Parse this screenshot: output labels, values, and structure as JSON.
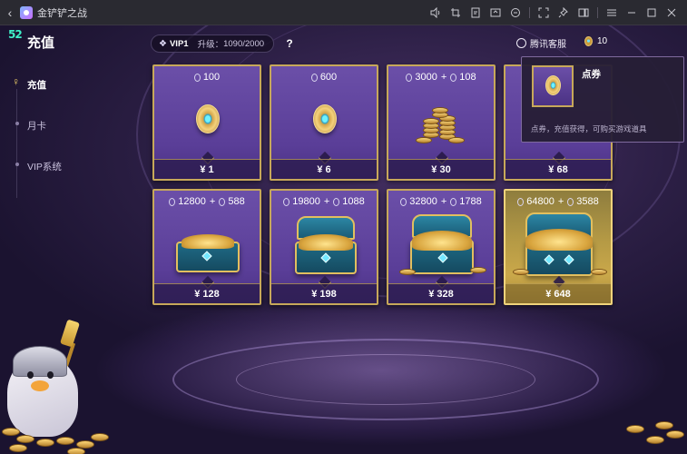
{
  "window": {
    "title": "金铲铲之战",
    "back_icon": "chevron-left-icon"
  },
  "header": {
    "page_title": "充值",
    "logo_text": "52",
    "vip": {
      "level": "VIP1",
      "upgrade_label": "升级：",
      "progress_current": "1090",
      "progress_total": "/2000"
    },
    "help_label": "?",
    "service_label": "腾讯客服",
    "coupon_balance": "10"
  },
  "nav": {
    "items": [
      {
        "label": "充值",
        "active": true
      },
      {
        "label": "月卡",
        "active": false
      },
      {
        "label": "VIP系统",
        "active": false
      }
    ]
  },
  "products": [
    {
      "amount": "100",
      "bonus": "",
      "price": "¥  1",
      "art": "coin"
    },
    {
      "amount": "600",
      "bonus": "",
      "price": "¥  6",
      "art": "coin"
    },
    {
      "amount": "3000",
      "bonus": "108",
      "price": "¥ 30",
      "art": "coin-stack"
    },
    {
      "amount": "",
      "bonus": "",
      "price": "¥ 68",
      "art": "hidden"
    },
    {
      "amount": "12800",
      "bonus": "588",
      "price": "¥ 128",
      "art": "chest-small"
    },
    {
      "amount": "19800",
      "bonus": "1088",
      "price": "¥ 198",
      "art": "chest-open"
    },
    {
      "amount": "32800",
      "bonus": "1788",
      "price": "¥ 328",
      "art": "chest-big"
    },
    {
      "amount": "64800",
      "bonus": "3588",
      "price": "¥ 648",
      "art": "chest-gold"
    }
  ],
  "tooltip": {
    "title": "点券",
    "description": "点券，充值获得，可购买游戏道具"
  },
  "colors": {
    "card_border": "#c7a85a",
    "card_bg": "#5a3e98",
    "gold_card_bg": "#b59a45",
    "accent_teal": "#3ff0c8"
  }
}
